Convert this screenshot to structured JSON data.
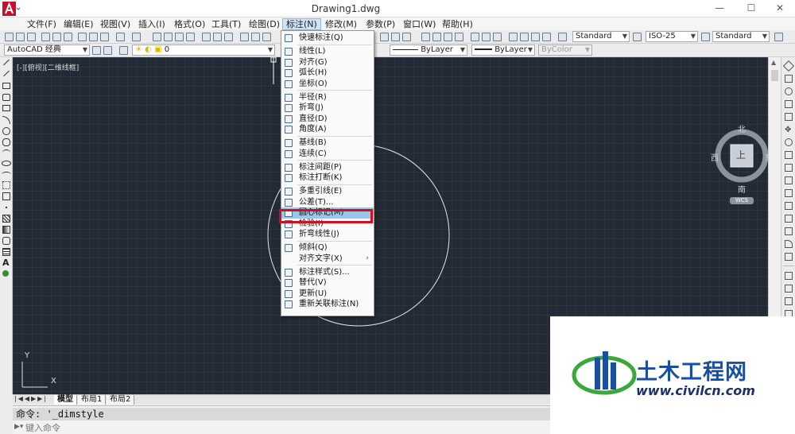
{
  "window": {
    "title": "Drawing1.dwg",
    "minimize_glyph": "—",
    "maximize_glyph": "☐",
    "close_glyph": "✕"
  },
  "menubar": [
    "文件(F)",
    "编辑(E)",
    "视图(V)",
    "插入(I)",
    "格式(O)",
    "工具(T)",
    "绘图(D)",
    "标注(N)",
    "修改(M)",
    "参数(P)",
    "窗口(W)",
    "帮助(H)"
  ],
  "toolbar": {
    "text_style": "Standard",
    "dim_style": "ISO-25",
    "table_style": "Standard",
    "workspace": "AutoCAD 经典",
    "layer": "0",
    "linetype": "ByLayer",
    "lineweight": "ByLayer",
    "plotstyle": "ByColor"
  },
  "viewport_label": "[-][俯视][二维线框]",
  "dim_menu": {
    "items": [
      {
        "label": "快速标注(Q)",
        "icon": "quick-dim-icon"
      },
      {
        "sep": true
      },
      {
        "label": "线性(L)",
        "icon": "linear-dim-icon"
      },
      {
        "label": "对齐(G)",
        "icon": "aligned-dim-icon"
      },
      {
        "label": "弧长(H)",
        "icon": "arc-length-icon"
      },
      {
        "label": "坐标(O)",
        "icon": "ordinate-icon"
      },
      {
        "sep": true
      },
      {
        "label": "半径(R)",
        "icon": "radius-icon"
      },
      {
        "label": "折弯(J)",
        "icon": "jogged-icon"
      },
      {
        "label": "直径(D)",
        "icon": "diameter-icon"
      },
      {
        "label": "角度(A)",
        "icon": "angle-icon"
      },
      {
        "sep": true
      },
      {
        "label": "基线(B)",
        "icon": "baseline-icon"
      },
      {
        "label": "连续(C)",
        "icon": "continue-icon"
      },
      {
        "sep": true
      },
      {
        "label": "标注间距(P)",
        "icon": "dim-space-icon"
      },
      {
        "label": "标注打断(K)",
        "icon": "dim-break-icon"
      },
      {
        "sep": true
      },
      {
        "label": "多重引线(E)",
        "icon": "mleader-icon"
      },
      {
        "label": "公差(T)...",
        "icon": "tolerance-icon"
      },
      {
        "label": "圆心标记(M)",
        "icon": "center-mark-icon",
        "highlighted": true
      },
      {
        "label": "检验(I)",
        "icon": "inspect-icon"
      },
      {
        "label": "折弯线性(J)",
        "icon": "jogged-linear-icon"
      },
      {
        "sep": true
      },
      {
        "label": "倾斜(Q)",
        "icon": "oblique-icon"
      },
      {
        "label": "对齐文字(X)",
        "icon": "",
        "submenu": true
      },
      {
        "sep": true
      },
      {
        "label": "标注样式(S)...",
        "icon": "dim-style-icon"
      },
      {
        "label": "替代(V)",
        "icon": "override-icon"
      },
      {
        "label": "更新(U)",
        "icon": "update-icon"
      },
      {
        "label": "重新关联标注(N)",
        "icon": "reassociate-icon"
      }
    ]
  },
  "viewcube": {
    "north": "北",
    "south": "南",
    "east": "东",
    "west": "西",
    "face": "上",
    "wcs": "WCS"
  },
  "ucs": {
    "x": "X",
    "y": "Y"
  },
  "tabs": [
    "模型",
    "布局1",
    "布局2"
  ],
  "command": {
    "history": "命令: '_dimstyle",
    "placeholder": "键入命令"
  },
  "watermark": {
    "brand": "土木工程网",
    "url": "www.civilcn.com"
  },
  "colors": {
    "canvas": "#222a35",
    "highlight_box": "#d01020",
    "menu_highlight": "#9cc5ec",
    "brand_blue": "#1a4fa0",
    "brand_green": "#3aa83a"
  }
}
